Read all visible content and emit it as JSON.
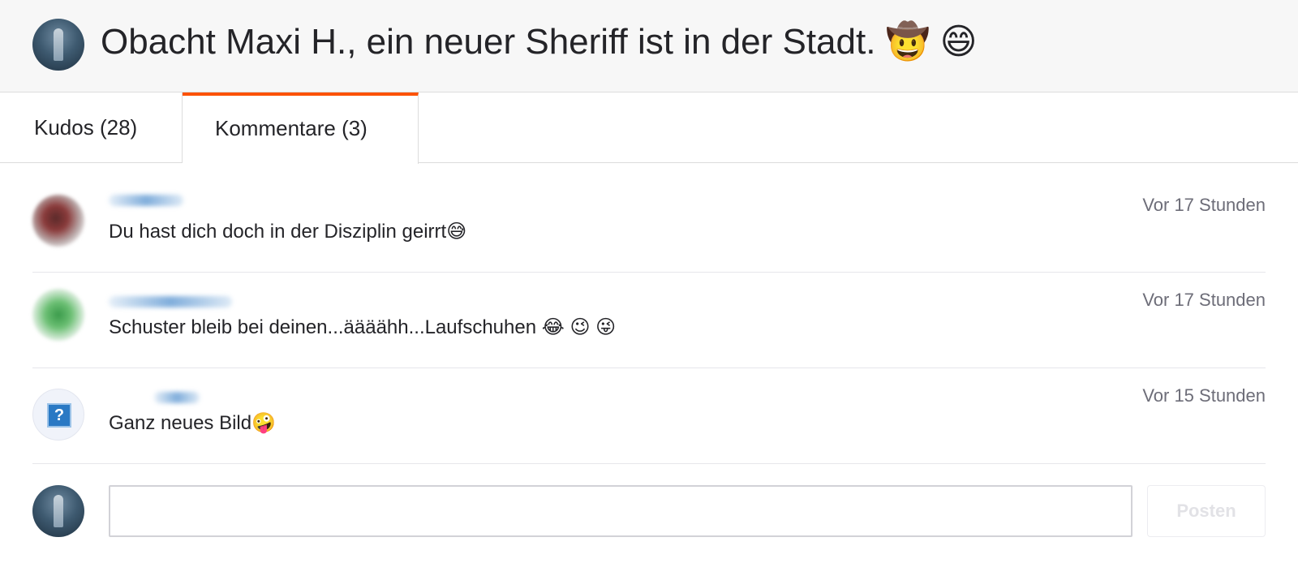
{
  "header": {
    "title": "Obacht Maxi H., ein neuer Sheriff ist in der Stadt. 🤠 😄"
  },
  "tabs": [
    {
      "label": "Kudos (28)",
      "active": false
    },
    {
      "label": "Kommentare (3)",
      "active": true
    }
  ],
  "comments": [
    {
      "text": "Du hast dich doch in der Disziplin geirrt😅",
      "time": "Vor 17 Stunden"
    },
    {
      "text": "Schuster bleib bei deinen...äääähh...Laufschuhen 😂 😉 😜",
      "time": "Vor 17 Stunden"
    },
    {
      "text": "Ganz neues Bild🤪",
      "time": "Vor 15 Stunden"
    }
  ],
  "composer": {
    "input_value": "",
    "post_label": "Posten"
  },
  "colors": {
    "accent": "#fc5200",
    "header_bg": "#f7f7f7",
    "muted_text": "#6d6d78",
    "disabled_text": "#e2e2e6"
  },
  "avatar_placeholder_glyph": "?"
}
